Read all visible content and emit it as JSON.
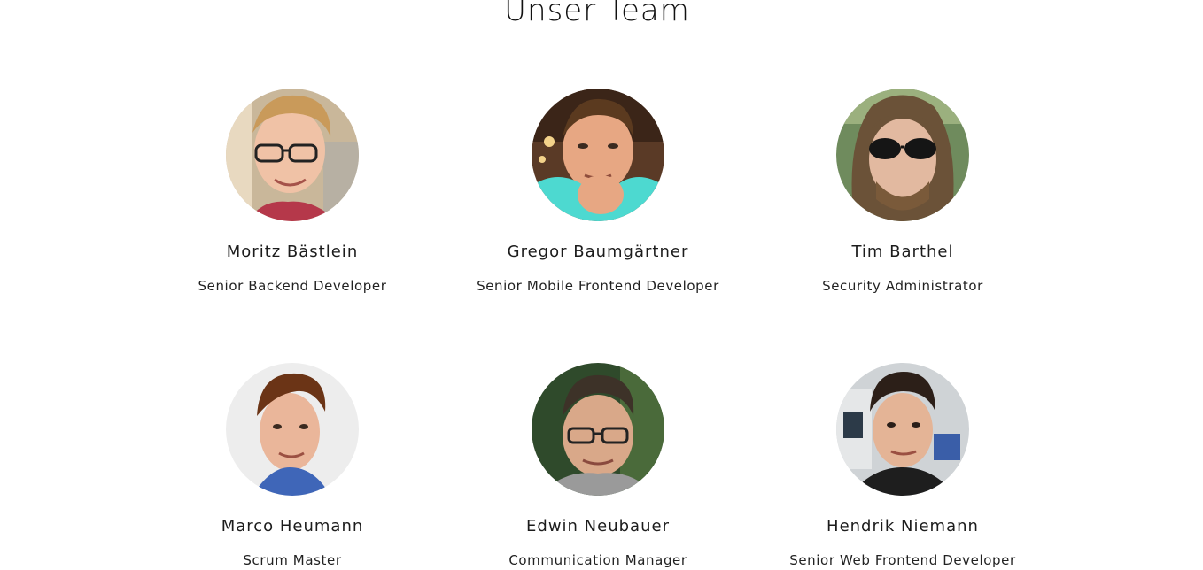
{
  "section": {
    "title": "Unser Team"
  },
  "team": [
    {
      "name": "Moritz Bästlein",
      "role": "Senior Backend Developer",
      "photo_icon": "person-photo-icon"
    },
    {
      "name": "Gregor Baumgärtner",
      "role": "Senior Mobile Frontend Developer",
      "photo_icon": "person-photo-icon"
    },
    {
      "name": "Tim Barthel",
      "role": "Security Administrator",
      "photo_icon": "person-photo-icon"
    },
    {
      "name": "Marco Heumann",
      "role": "Scrum Master",
      "photo_icon": "person-photo-icon"
    },
    {
      "name": "Edwin Neubauer",
      "role": "Communication Manager",
      "photo_icon": "person-photo-icon"
    },
    {
      "name": "Hendrik Niemann",
      "role": "Senior Web Frontend Developer",
      "photo_icon": "person-photo-icon"
    }
  ],
  "colors": {
    "text": "#1a1a1a",
    "background": "#ffffff"
  }
}
